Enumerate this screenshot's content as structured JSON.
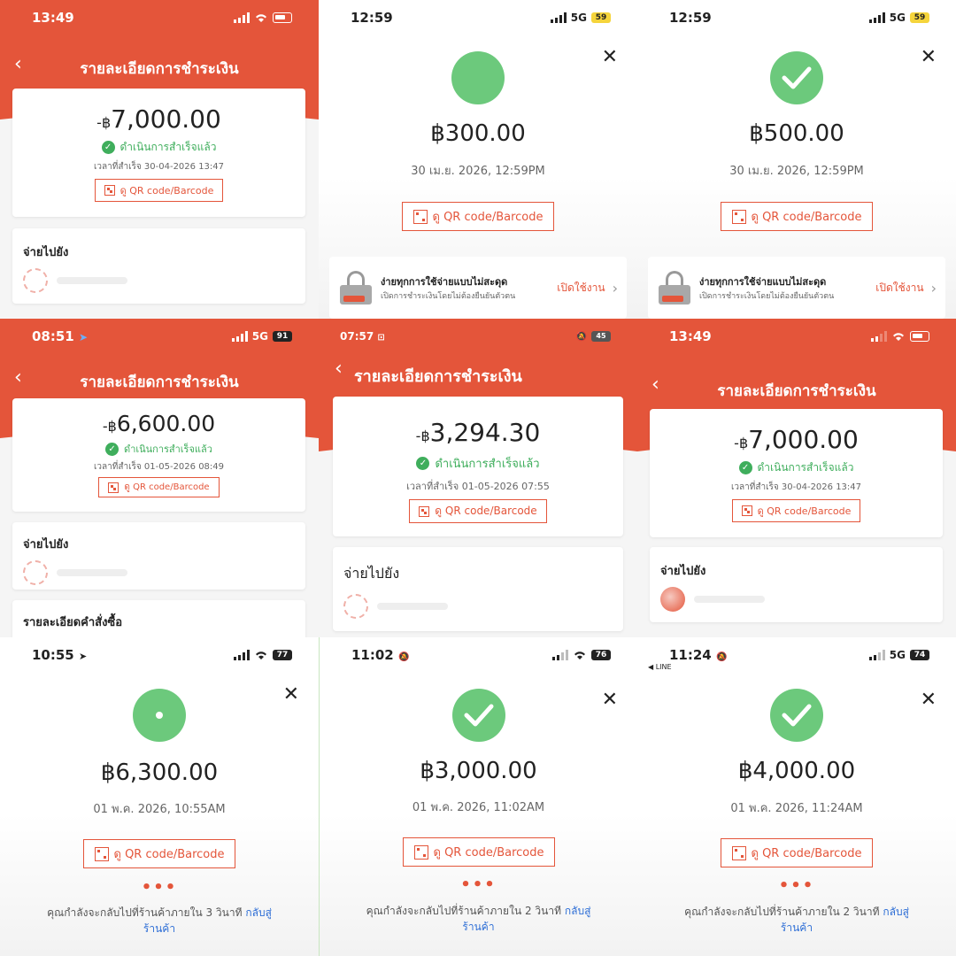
{
  "colors": {
    "brand": "#e4553a",
    "success": "#3fae5c",
    "check_bg": "#6cc97c",
    "link": "#2f6fd6"
  },
  "common": {
    "title": "รายละเอียดการชำระเงิน",
    "qr_label": "ดู QR code/Barcode",
    "status_ok": "ดำเนินการสำเร็จแล้ว",
    "pay_to": "จ่ายไปยัง",
    "promo_title": "ง่ายทุกการใช้จ่ายแบบไม่สะดุด",
    "promo_sub": "เปิดการชำระเงินโดยไม่ต้องยืนยันตัวตน",
    "promo_action": "เปิดใช้งาน",
    "order_details": "รายละเอียดคำสั่งซื้อ",
    "dots": "•••",
    "back_link_a": "กลับสู่",
    "back_link_b": "ร้านค้า"
  },
  "screens": [
    {
      "time": "13:49",
      "battery": "",
      "amount_prefix": "-฿",
      "amount": "7,000.00",
      "completed": "เวลาที่สำเร็จ 30-04-2026 13:47"
    },
    {
      "time": "12:59",
      "network": "5G",
      "battery": "59",
      "amount": "฿300.00",
      "datetime": "30 เม.ย. 2026, 12:59PM"
    },
    {
      "time": "12:59",
      "network": "5G",
      "battery": "59",
      "amount": "฿500.00",
      "datetime": "30 เม.ย. 2026, 12:59PM"
    },
    {
      "time": "08:51",
      "network": "5G",
      "battery": "91",
      "amount_prefix": "-฿",
      "amount": "6,600.00",
      "completed": "เวลาที่สำเร็จ 01-05-2026 08:49"
    },
    {
      "time": "07:57",
      "battery": "45",
      "amount_prefix": "-฿",
      "amount": "3,294.30",
      "completed": "เวลาที่สำเร็จ 01-05-2026 07:55"
    },
    {
      "time": "13:49",
      "battery": "",
      "amount_prefix": "-฿",
      "amount": "7,000.00",
      "completed": "เวลาที่สำเร็จ 30-04-2026 13:47"
    },
    {
      "time": "10:55",
      "battery": "77",
      "amount": "฿6,300.00",
      "datetime": "01 พ.ค. 2026, 10:55AM",
      "redirect": "คุณกำลังจะกลับไปที่ร้านค้าภายใน 3 วินาที"
    },
    {
      "time": "11:02",
      "battery": "76",
      "amount": "฿3,000.00",
      "datetime": "01 พ.ค. 2026, 11:02AM",
      "redirect": "คุณกำลังจะกลับไปที่ร้านค้าภายใน 2 วินาที"
    },
    {
      "time": "11:24",
      "network": "5G",
      "battery": "74",
      "back_app": "◀ LINE",
      "amount": "฿4,000.00",
      "datetime": "01 พ.ค. 2026, 11:24AM",
      "redirect": "คุณกำลังจะกลับไปที่ร้านค้าภายใน 2 วินาที"
    }
  ]
}
